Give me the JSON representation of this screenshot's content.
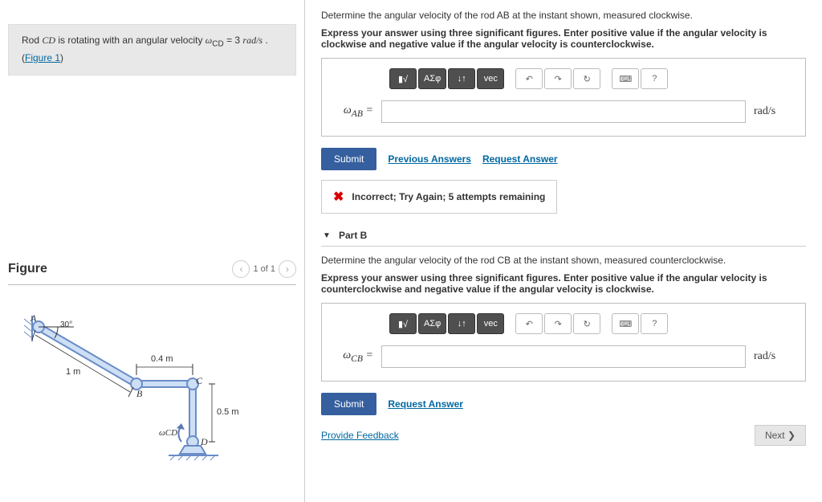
{
  "left": {
    "prob_prefix": "Rod ",
    "prob_cd": "CD",
    "prob_mid1": " is rotating with an angular velocity ",
    "prob_omega": "ω",
    "prob_cd_sub": "CD",
    "prob_mid2": " = 3 ",
    "prob_units": "rad/s",
    "prob_mid3": " . (",
    "figure_link": "Figure 1",
    "prob_end": ")",
    "figure_title": "Figure",
    "nav_prev": "‹",
    "nav_text": "1 of 1",
    "nav_next": "›",
    "fig_labels": {
      "angle": "30°",
      "ab": "1 m",
      "bc": "0.4 m",
      "cd": "0.5 m",
      "omega": "ωCD",
      "A": "A",
      "B": "B",
      "C": "C",
      "D": "D"
    }
  },
  "toolbar": {
    "b1": "▮√",
    "b2": "ΑΣφ",
    "b3": "↓↑",
    "b4": "vec",
    "undo": "↶",
    "redo": "↷",
    "reset": "↻",
    "kb": "⌨",
    "help": "?"
  },
  "partA": {
    "q": "Determine the angular velocity of the rod AB at the instant shown, measured clockwise.",
    "instr": "Express your answer using three significant figures. Enter positive value if the angular velocity is clockwise and negative value if the angular velocity is counterclockwise.",
    "var": "ω",
    "sub": "AB",
    "eq": " = ",
    "unit": "rad/s",
    "submit": "Submit",
    "prev_answers": "Previous Answers",
    "req_answer": "Request Answer",
    "feedback": "Incorrect; Try Again; 5 attempts remaining"
  },
  "partB": {
    "title": "Part B",
    "q": "Determine the angular velocity of the rod CB at the instant shown, measured counterclockwise.",
    "instr": "Express your answer using three significant figures. Enter positive value if the angular velocity is counterclockwise and negative value if the angular velocity is clockwise.",
    "var": "ω",
    "sub": "CB",
    "eq": " = ",
    "unit": "rad/s",
    "submit": "Submit",
    "req_answer": "Request Answer"
  },
  "bottom": {
    "feedback_link": "Provide Feedback",
    "next": "Next ❯"
  }
}
